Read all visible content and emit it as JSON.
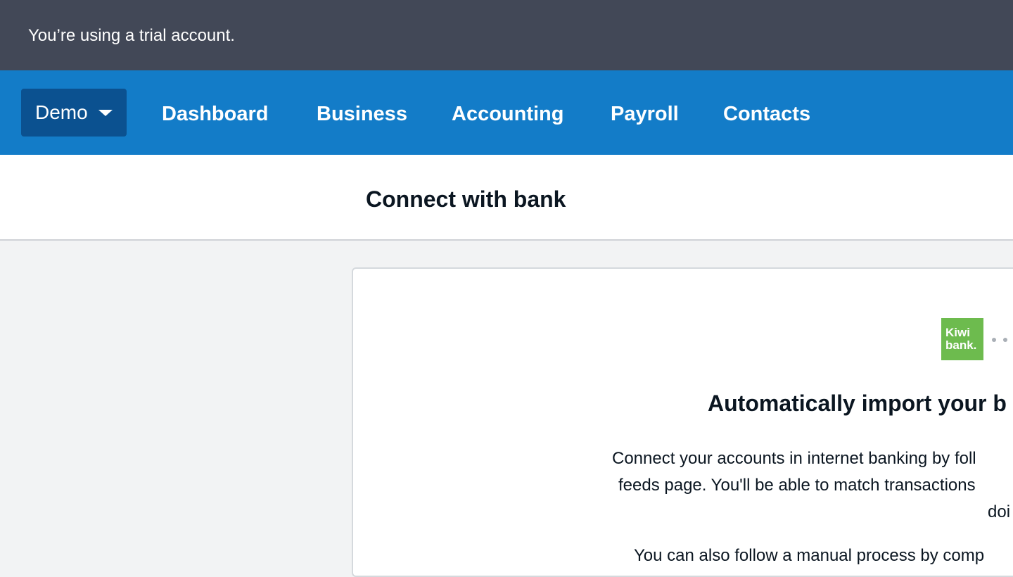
{
  "banner": {
    "text": "You’re using a trial account."
  },
  "nav": {
    "org_label": "Demo",
    "items": [
      {
        "label": "Dashboard"
      },
      {
        "label": "Business"
      },
      {
        "label": "Accounting"
      },
      {
        "label": "Payroll"
      },
      {
        "label": "Contacts"
      }
    ]
  },
  "page": {
    "title": "Connect with bank"
  },
  "card": {
    "bank_logo": {
      "line1": "Kiwi",
      "line2": "bank."
    },
    "heading": "Automatically import your b",
    "paragraph_lines": [
      "Connect your accounts in internet banking by foll",
      "feeds page. You'll be able to match transactions",
      "doi"
    ],
    "second_paragraph": "You can also follow a manual process by comp"
  },
  "colors": {
    "banner_bg": "#424857",
    "nav_bg": "#137cc8",
    "org_switcher_bg": "#0b5190",
    "kiwibank_green": "#6dbb4e"
  }
}
